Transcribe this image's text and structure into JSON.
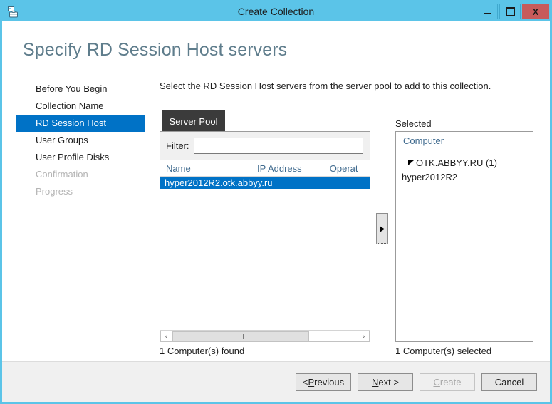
{
  "window": {
    "title": "Create Collection",
    "icon": "server-collection-icon",
    "caption_buttons": {
      "minimize": "minimize-icon",
      "maximize": "maximize-icon",
      "close": "X"
    },
    "accent_color": "#5BC4E8",
    "close_color": "#C75B5B"
  },
  "page": {
    "heading": "Specify RD Session Host servers",
    "heading_color": "#5F7D8C",
    "instruction": "Select the RD Session Host servers from the server pool to add to this collection."
  },
  "sidebar": {
    "selected_color": "#0072C6",
    "items": [
      {
        "label": "Before You Begin",
        "state": "normal"
      },
      {
        "label": "Collection Name",
        "state": "normal"
      },
      {
        "label": "RD Session Host",
        "state": "selected"
      },
      {
        "label": "User Groups",
        "state": "normal"
      },
      {
        "label": "User Profile Disks",
        "state": "normal"
      },
      {
        "label": "Confirmation",
        "state": "disabled"
      },
      {
        "label": "Progress",
        "state": "disabled"
      }
    ]
  },
  "server_pool": {
    "tab_label": "Server Pool",
    "filter_label": "Filter:",
    "filter_value": "",
    "filter_placeholder": "",
    "columns": [
      "Name",
      "IP Address",
      "Operat"
    ],
    "rows": [
      {
        "name": "hyper2012R2.otk.abbyy.ru",
        "ip": "",
        "os": "",
        "selected": true
      }
    ],
    "status": "1 Computer(s) found",
    "scrollbar": {
      "left_arrow": "‹",
      "right_arrow": "›",
      "grip": "III"
    }
  },
  "move_button": {
    "label": "move-right-arrow",
    "glyph": "▶"
  },
  "selected_panel": {
    "label": "Selected",
    "column_header": "Computer",
    "tree": {
      "toggle_glyph": "◢",
      "group_label": "OTK.ABBYY.RU (1)",
      "children": [
        "hyper2012R2"
      ]
    },
    "status": "1 Computer(s) selected"
  },
  "footer": {
    "buttons": [
      {
        "label_pre": "< ",
        "label_accel": "P",
        "label_post": "revious",
        "name": "previous",
        "disabled": false
      },
      {
        "label_pre": "",
        "label_accel": "N",
        "label_post": "ext >",
        "name": "next",
        "disabled": false
      },
      {
        "label_pre": "",
        "label_accel": "C",
        "label_post": "reate",
        "name": "create",
        "disabled": true
      },
      {
        "label_pre": "",
        "label_accel": "",
        "label_post": "Cancel",
        "name": "cancel",
        "disabled": false
      }
    ]
  }
}
